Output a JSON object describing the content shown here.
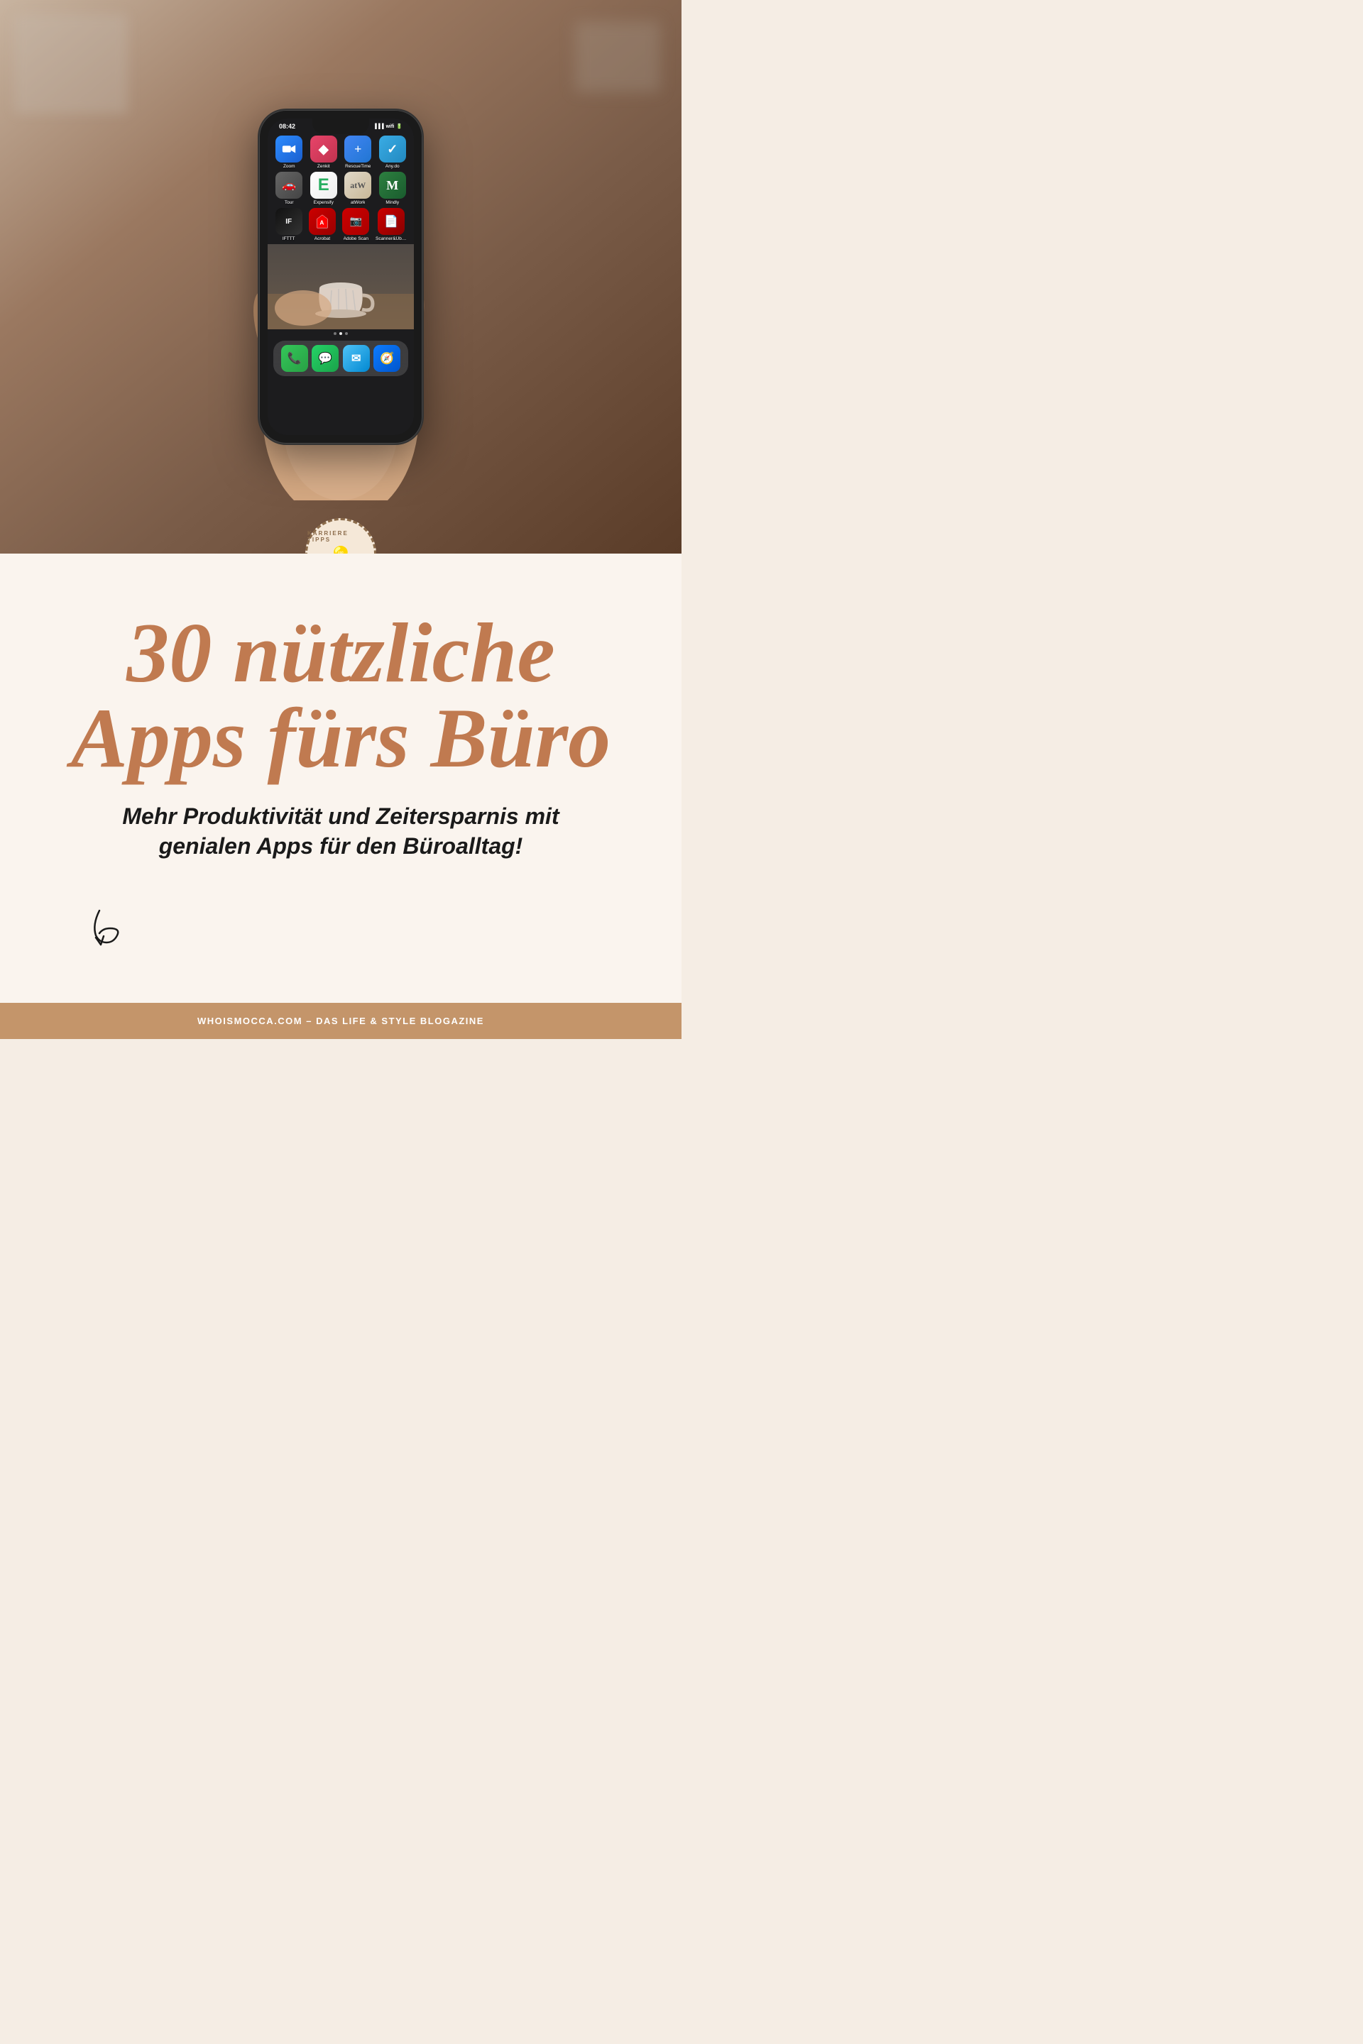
{
  "page": {
    "title": "30 nützliche Apps fürs Büro",
    "subtitle_line1": "Mehr Produktivität und Zeitersparnis mit",
    "subtitle_line2": "genialen Apps für den Büroalltag!"
  },
  "badge": {
    "top_text": "KARRIERE TIPPS",
    "icon": "💡"
  },
  "phone": {
    "time": "08:42",
    "apps_row1": [
      {
        "label": "Zoom",
        "class": "zoom-app",
        "icon": "📹"
      },
      {
        "label": "Zenkit",
        "class": "zenkit-app",
        "icon": "◆"
      },
      {
        "label": "RescueTime",
        "class": "rescuetime-app",
        "icon": "➕"
      },
      {
        "label": "Any.do",
        "class": "anydo-app",
        "icon": "✓"
      }
    ],
    "apps_row2": [
      {
        "label": "Tour",
        "class": "tour-app",
        "icon": "🚗"
      },
      {
        "label": "Expensify",
        "class": "expensify-app",
        "icon": "E"
      },
      {
        "label": "atWork",
        "class": "atwork-app",
        "icon": "⚙"
      },
      {
        "label": "Mindly",
        "class": "mindly-app",
        "icon": "M"
      }
    ],
    "apps_row3": [
      {
        "label": "IFTTT",
        "class": "ifttt-app",
        "icon": "IF"
      },
      {
        "label": "Acrobat",
        "class": "acrobat-app",
        "icon": "A"
      },
      {
        "label": "Adobe Scan",
        "class": "adobescan-app",
        "icon": "📷"
      },
      {
        "label": "Scanner&Übers...",
        "class": "scanner-app",
        "icon": "📄"
      }
    ],
    "dock": [
      {
        "label": "Phone",
        "class": "phone-app",
        "icon": "📞"
      },
      {
        "label": "WhatsApp",
        "class": "whatsapp-app",
        "icon": "💬"
      },
      {
        "label": "Mail",
        "class": "mail-app",
        "icon": "✉"
      },
      {
        "label": "Safari",
        "class": "safari-app",
        "icon": "🧭"
      }
    ]
  },
  "footer": {
    "text": "WHOISMOCCA.COM – DAS LIFE & STYLE BLOGAZINE"
  }
}
